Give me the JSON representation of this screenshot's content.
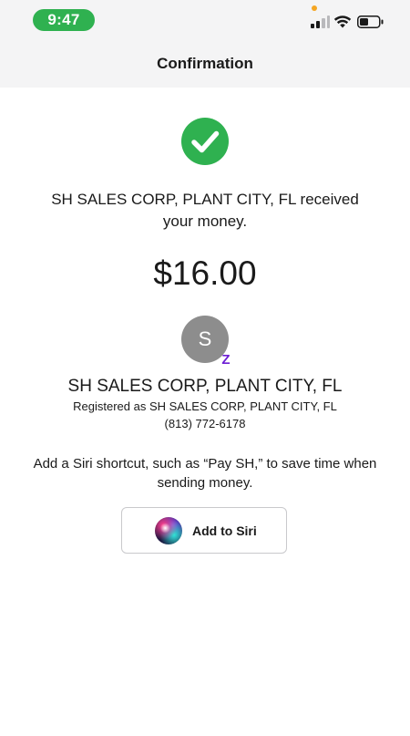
{
  "status_bar": {
    "time": "9:47",
    "time_pill_color": "#2fb150",
    "privacy_dot_color": "#f5a623"
  },
  "header": {
    "title": "Confirmation"
  },
  "confirmation": {
    "icon": "check-circle-icon",
    "icon_color": "#2fb150",
    "message": "SH SALES CORP, PLANT CITY, FL received your money.",
    "amount": "$16.00"
  },
  "recipient": {
    "avatar_initial": "S",
    "badge_glyph": "Z",
    "badge_color": "#6d1ed4",
    "name": "SH SALES CORP, PLANT CITY, FL",
    "registered": "Registered as SH SALES CORP, PLANT CITY, FL",
    "phone": "(813) 772-6178"
  },
  "siri": {
    "hint": "Add a Siri shortcut, such as “Pay SH,” to save time when sending money.",
    "button_label": "Add to Siri",
    "icon": "siri-orb-icon"
  }
}
